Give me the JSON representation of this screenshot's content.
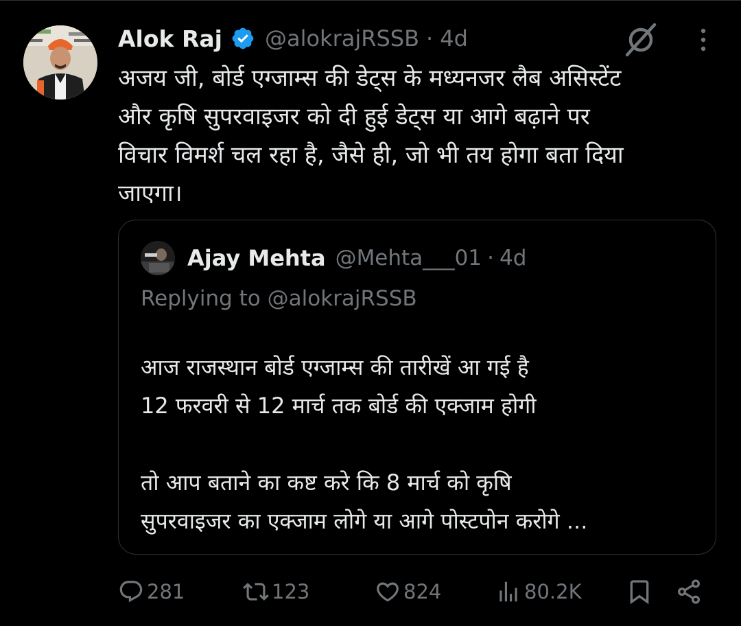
{
  "tweet": {
    "author_name": "Alok Raj",
    "handle": "@alokrajRSSB",
    "separator": "·",
    "time": "4d",
    "text_lines": [
      "अजय जी, बोर्ड एग्जाम्स की डेट्स के मध्यनजर लैब असिस्टेंट",
      "और कृषि सुपरवाइजर को दी हुई  डेट्स या आगे बढ़ाने पर",
      "विचार विमर्श चल रहा है, जैसे ही, जो भी तय होगा बता दिया",
      "जाएगा।"
    ]
  },
  "quote": {
    "author_name": "Ajay Mehta",
    "handle": "@Mehta___01",
    "separator": "·",
    "time": "4d",
    "replying_prefix": "Replying to ",
    "replying_handle": "@alokrajRSSB",
    "text_lines": [
      "आज राजस्थान बोर्ड एग्जाम्स की तारीखें आ गई है",
      "12 फरवरी से 12 मार्च तक बोर्ड की एक्जाम होगी",
      "",
      "तो आप बताने का कष्ट करे कि 8 मार्च को कृषि",
      "सुपरवाइजर का एक्जाम लोगे या आगे पोस्टपोन करोगे ..."
    ]
  },
  "actions": {
    "replies": "281",
    "reposts": "123",
    "likes": "824",
    "views": "80.2K"
  },
  "colors": {
    "background": "#000000",
    "text": "#e7e9ea",
    "secondary": "#71767b",
    "verified": "#1d9bf0",
    "border": "#2f3336"
  },
  "icons": [
    "verified-badge-icon",
    "grok-icon",
    "more-icon",
    "reply-icon",
    "repost-icon",
    "like-icon",
    "views-icon",
    "bookmark-icon",
    "share-icon"
  ]
}
